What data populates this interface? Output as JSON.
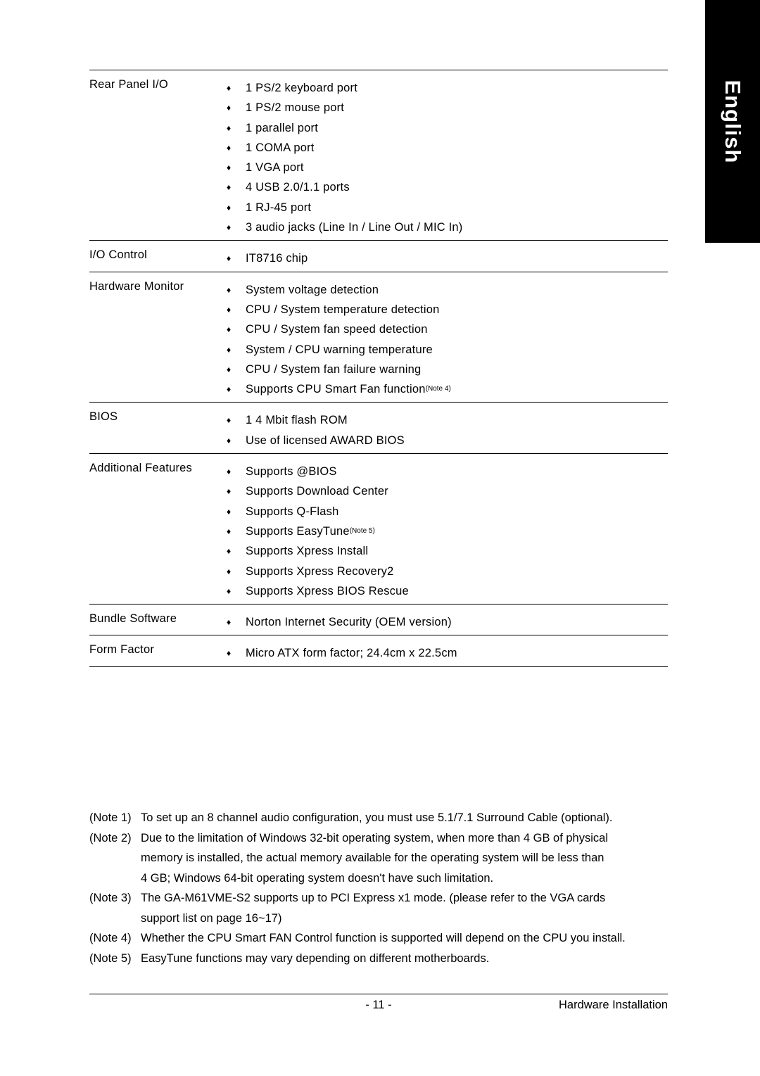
{
  "side_tab": {
    "label": "English"
  },
  "spec_table": {
    "bullet_glyph": "♦",
    "rows": [
      {
        "label": "Rear Panel I/O",
        "items": [
          {
            "text": "1 PS/2 keyboard port"
          },
          {
            "text": "1 PS/2 mouse port"
          },
          {
            "text": "1 parallel port"
          },
          {
            "text": "1 COMA port"
          },
          {
            "text": "1 VGA port"
          },
          {
            "text": "4 USB 2.0/1.1 ports"
          },
          {
            "text": "1 RJ-45 port"
          },
          {
            "text": "3 audio jacks (Line In / Line Out / MIC In)"
          }
        ]
      },
      {
        "label": "I/O Control",
        "items": [
          {
            "text": "IT8716 chip"
          }
        ]
      },
      {
        "label": "Hardware Monitor",
        "items": [
          {
            "text": "System voltage detection"
          },
          {
            "text": "CPU / System temperature detection"
          },
          {
            "text": "CPU / System fan speed detection"
          },
          {
            "text": "System / CPU warning temperature"
          },
          {
            "text": "CPU / System fan failure warning"
          },
          {
            "text": "Supports CPU Smart Fan function ",
            "sup": "(Note 4)"
          }
        ]
      },
      {
        "label": "BIOS",
        "items": [
          {
            "text": "1 4 Mbit flash ROM"
          },
          {
            "text": "Use of licensed AWARD BIOS"
          }
        ]
      },
      {
        "label": "Additional Features",
        "items": [
          {
            "text": "Supports @BIOS"
          },
          {
            "text": "Supports Download Center"
          },
          {
            "text": "Supports Q-Flash"
          },
          {
            "text": "Supports EasyTune ",
            "sup": "(Note 5)"
          },
          {
            "text": "Supports Xpress Install"
          },
          {
            "text": "Supports Xpress Recovery2"
          },
          {
            "text": "Supports Xpress BIOS Rescue"
          }
        ]
      },
      {
        "label": "Bundle Software",
        "items": [
          {
            "text": "Norton Internet Security (OEM version)"
          }
        ]
      },
      {
        "label": "Form Factor",
        "items": [
          {
            "text": "Micro ATX form factor; 24.4cm x 22.5cm"
          }
        ]
      }
    ]
  },
  "notes": [
    {
      "tag": "(Note 1)",
      "lines": [
        "To set up an 8 channel audio configuration, you must use 5.1/7.1 Surround Cable (optional)."
      ]
    },
    {
      "tag": "(Note 2)",
      "lines": [
        "Due to the limitation of Windows 32-bit operating system, when more than 4 GB of physical",
        "memory is installed, the actual memory available for the operating system will be less than",
        "4 GB; Windows 64-bit operating system doesn't have such limitation."
      ]
    },
    {
      "tag": "(Note 3)",
      "lines": [
        "The GA-M61VME-S2 supports up to PCI Express x1 mode. (please refer to the VGA cards",
        "support list on page 16~17)"
      ]
    },
    {
      "tag": "(Note 4)",
      "lines": [
        "Whether the CPU Smart FAN Control function is supported will depend on the CPU you install."
      ]
    },
    {
      "tag": "(Note 5)",
      "lines": [
        "EasyTune functions may vary depending on different motherboards."
      ]
    }
  ],
  "footer": {
    "page_number": "- 11 -",
    "chapter": "Hardware Installation"
  }
}
